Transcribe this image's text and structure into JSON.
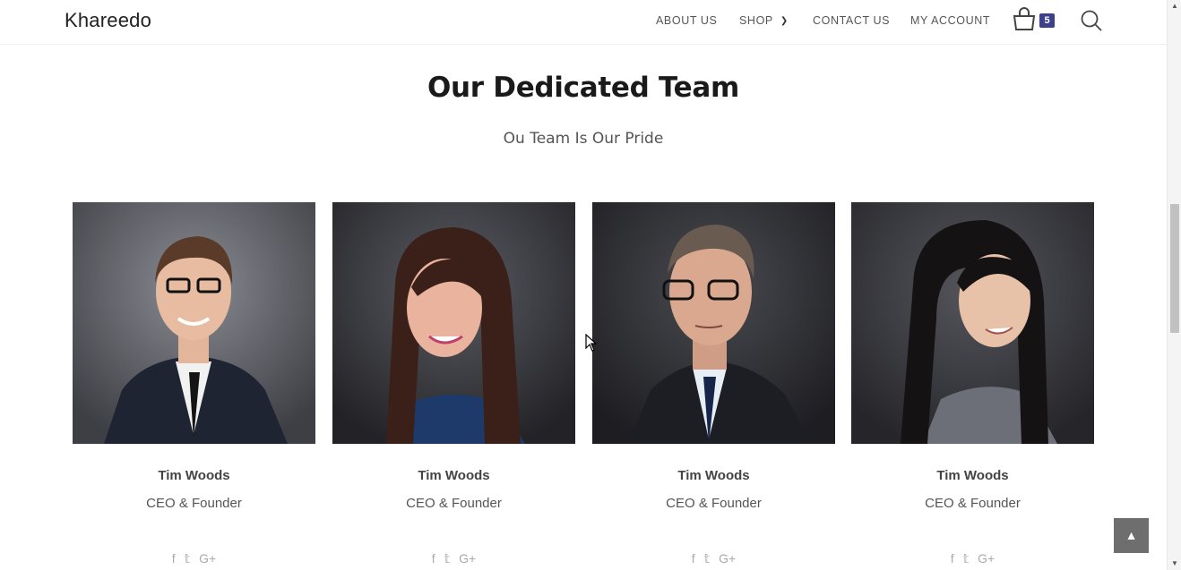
{
  "header": {
    "brand": "Khareedo",
    "nav": [
      {
        "label": "ABOUT US"
      },
      {
        "label": "SHOP"
      },
      {
        "label": "CONTACT US"
      },
      {
        "label": "MY ACCOUNT"
      }
    ],
    "cart_count": "5",
    "icons": {
      "cart": "shopping-bag-icon",
      "search": "search-icon",
      "shop_dropdown": "chevron-down-icon"
    }
  },
  "section": {
    "title": "Our Dedicated Team",
    "subtitle": "Ou Team Is Our Pride"
  },
  "team": [
    {
      "name": "Tim Woods",
      "role": "CEO & Founder"
    },
    {
      "name": "Tim Woods",
      "role": "CEO & Founder"
    },
    {
      "name": "Tim Woods",
      "role": "CEO & Founder"
    },
    {
      "name": "Tim Woods",
      "role": "CEO & Founder"
    }
  ],
  "social": {
    "facebook": "f",
    "twitter": "t",
    "google_plus": "G+"
  },
  "colors": {
    "badge": "#3b3f8c",
    "back_to_top": "#6e6e6e",
    "title": "#1a1a1a"
  }
}
